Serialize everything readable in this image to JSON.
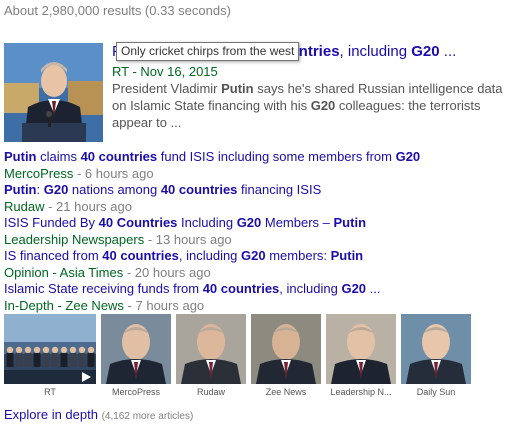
{
  "result_stats": "About 2,980,000 results (0.33 seconds)",
  "tooltip": "Only cricket chirps from the west",
  "top_story": {
    "title_left": "P",
    "title_bold1": "countries",
    "title_mid": ", including ",
    "title_bold2": "G20",
    "title_end": " ...",
    "source": "RT",
    "date": "Nov 16, 2015",
    "snippet_1": "President Vladimir ",
    "snippet_putin": "Putin",
    "snippet_2": " says he's shared Russian intelligence data on Islamic State financing with his ",
    "snippet_g20": "G20",
    "snippet_3": " colleagues: the terrorists appear to ..."
  },
  "related": [
    {
      "title_parts": [
        {
          "t": "Putin",
          "b": true
        },
        {
          "t": " claims ",
          "b": false
        },
        {
          "t": "40 countries",
          "b": true
        },
        {
          "t": " fund ISIS including some members from ",
          "b": false
        },
        {
          "t": "G20",
          "b": true
        }
      ],
      "source": "MercoPress",
      "when": "6 hours ago"
    },
    {
      "title_parts": [
        {
          "t": "Putin",
          "b": true
        },
        {
          "t": ": ",
          "b": false
        },
        {
          "t": "G20",
          "b": true
        },
        {
          "t": " nations among ",
          "b": false
        },
        {
          "t": "40 countries",
          "b": true
        },
        {
          "t": " financing ISIS",
          "b": false
        }
      ],
      "source": "Rudaw",
      "when": "21 hours ago"
    },
    {
      "title_parts": [
        {
          "t": "ISIS Funded By ",
          "b": false
        },
        {
          "t": "40 Countries",
          "b": true
        },
        {
          "t": " Including ",
          "b": false
        },
        {
          "t": "G20",
          "b": true
        },
        {
          "t": " Members – ",
          "b": false
        },
        {
          "t": "Putin",
          "b": true
        }
      ],
      "source": "Leadership Newspapers",
      "when": "13 hours ago"
    },
    {
      "title_parts": [
        {
          "t": "IS financed from ",
          "b": false
        },
        {
          "t": "40 countries",
          "b": true
        },
        {
          "t": ", including ",
          "b": false
        },
        {
          "t": "G20",
          "b": true
        },
        {
          "t": " members: ",
          "b": false
        },
        {
          "t": "Putin",
          "b": true
        }
      ],
      "source": "Opinion - Asia Times",
      "when": "20 hours ago"
    },
    {
      "title_parts": [
        {
          "t": "Islamic State receiving funds from ",
          "b": false
        },
        {
          "t": "40 countries",
          "b": true
        },
        {
          "t": ", including ",
          "b": false
        },
        {
          "t": "G20",
          "b": true
        },
        {
          "t": " ...",
          "b": false
        }
      ],
      "source": "In-Depth - Zee News",
      "when": "7 hours ago"
    }
  ],
  "thumbnails": [
    {
      "caption": "RT",
      "icon": "video-play-icon"
    },
    {
      "caption": "MercoPress"
    },
    {
      "caption": "Rudaw"
    },
    {
      "caption": "Zee News"
    },
    {
      "caption": "Leadership N..."
    },
    {
      "caption": "Daily Sun"
    }
  ],
  "explore": {
    "label": "Explore in depth",
    "count": "(4,162 more articles)"
  },
  "colors": {
    "link": "#1a0dab",
    "source": "#006621",
    "muted": "#808080",
    "snippet": "#545454"
  }
}
